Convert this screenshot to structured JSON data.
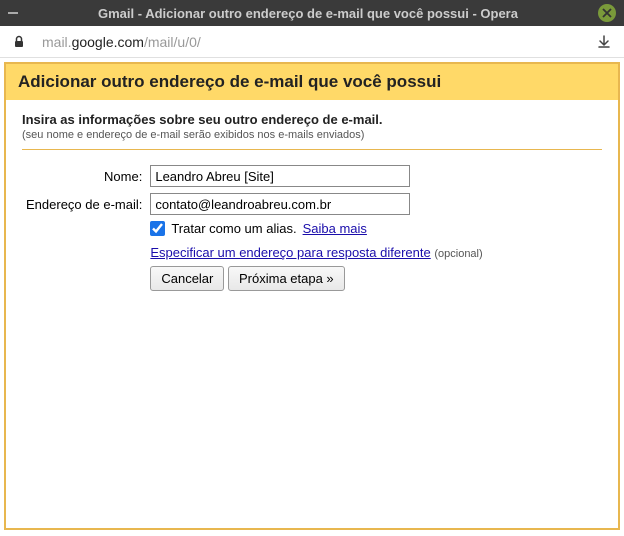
{
  "window": {
    "title": "Gmail - Adicionar outro endereço de e-mail que você possui - Opera"
  },
  "address": {
    "url_gray1": "mail.",
    "url_dark": "google.com",
    "url_gray2": "/mail/u/0/"
  },
  "header": {
    "title": "Adicionar outro endereço de e-mail que você possui"
  },
  "instruction": {
    "main": "Insira as informações sobre seu outro endereço de e-mail.",
    "sub": "(seu nome e endereço de e-mail serão exibidos nos e-mails enviados)"
  },
  "form": {
    "name_label": "Nome:",
    "name_value": "Leandro Abreu [Site]",
    "email_label": "Endereço de e-mail:",
    "email_value": "contato@leandroabreu.com.br",
    "alias_text": "Tratar como um alias.",
    "learn_more": "Saiba mais",
    "reply_link": "Especificar um endereço para resposta diferente",
    "optional": "(opcional)"
  },
  "buttons": {
    "cancel": "Cancelar",
    "next": "Próxima etapa »"
  }
}
